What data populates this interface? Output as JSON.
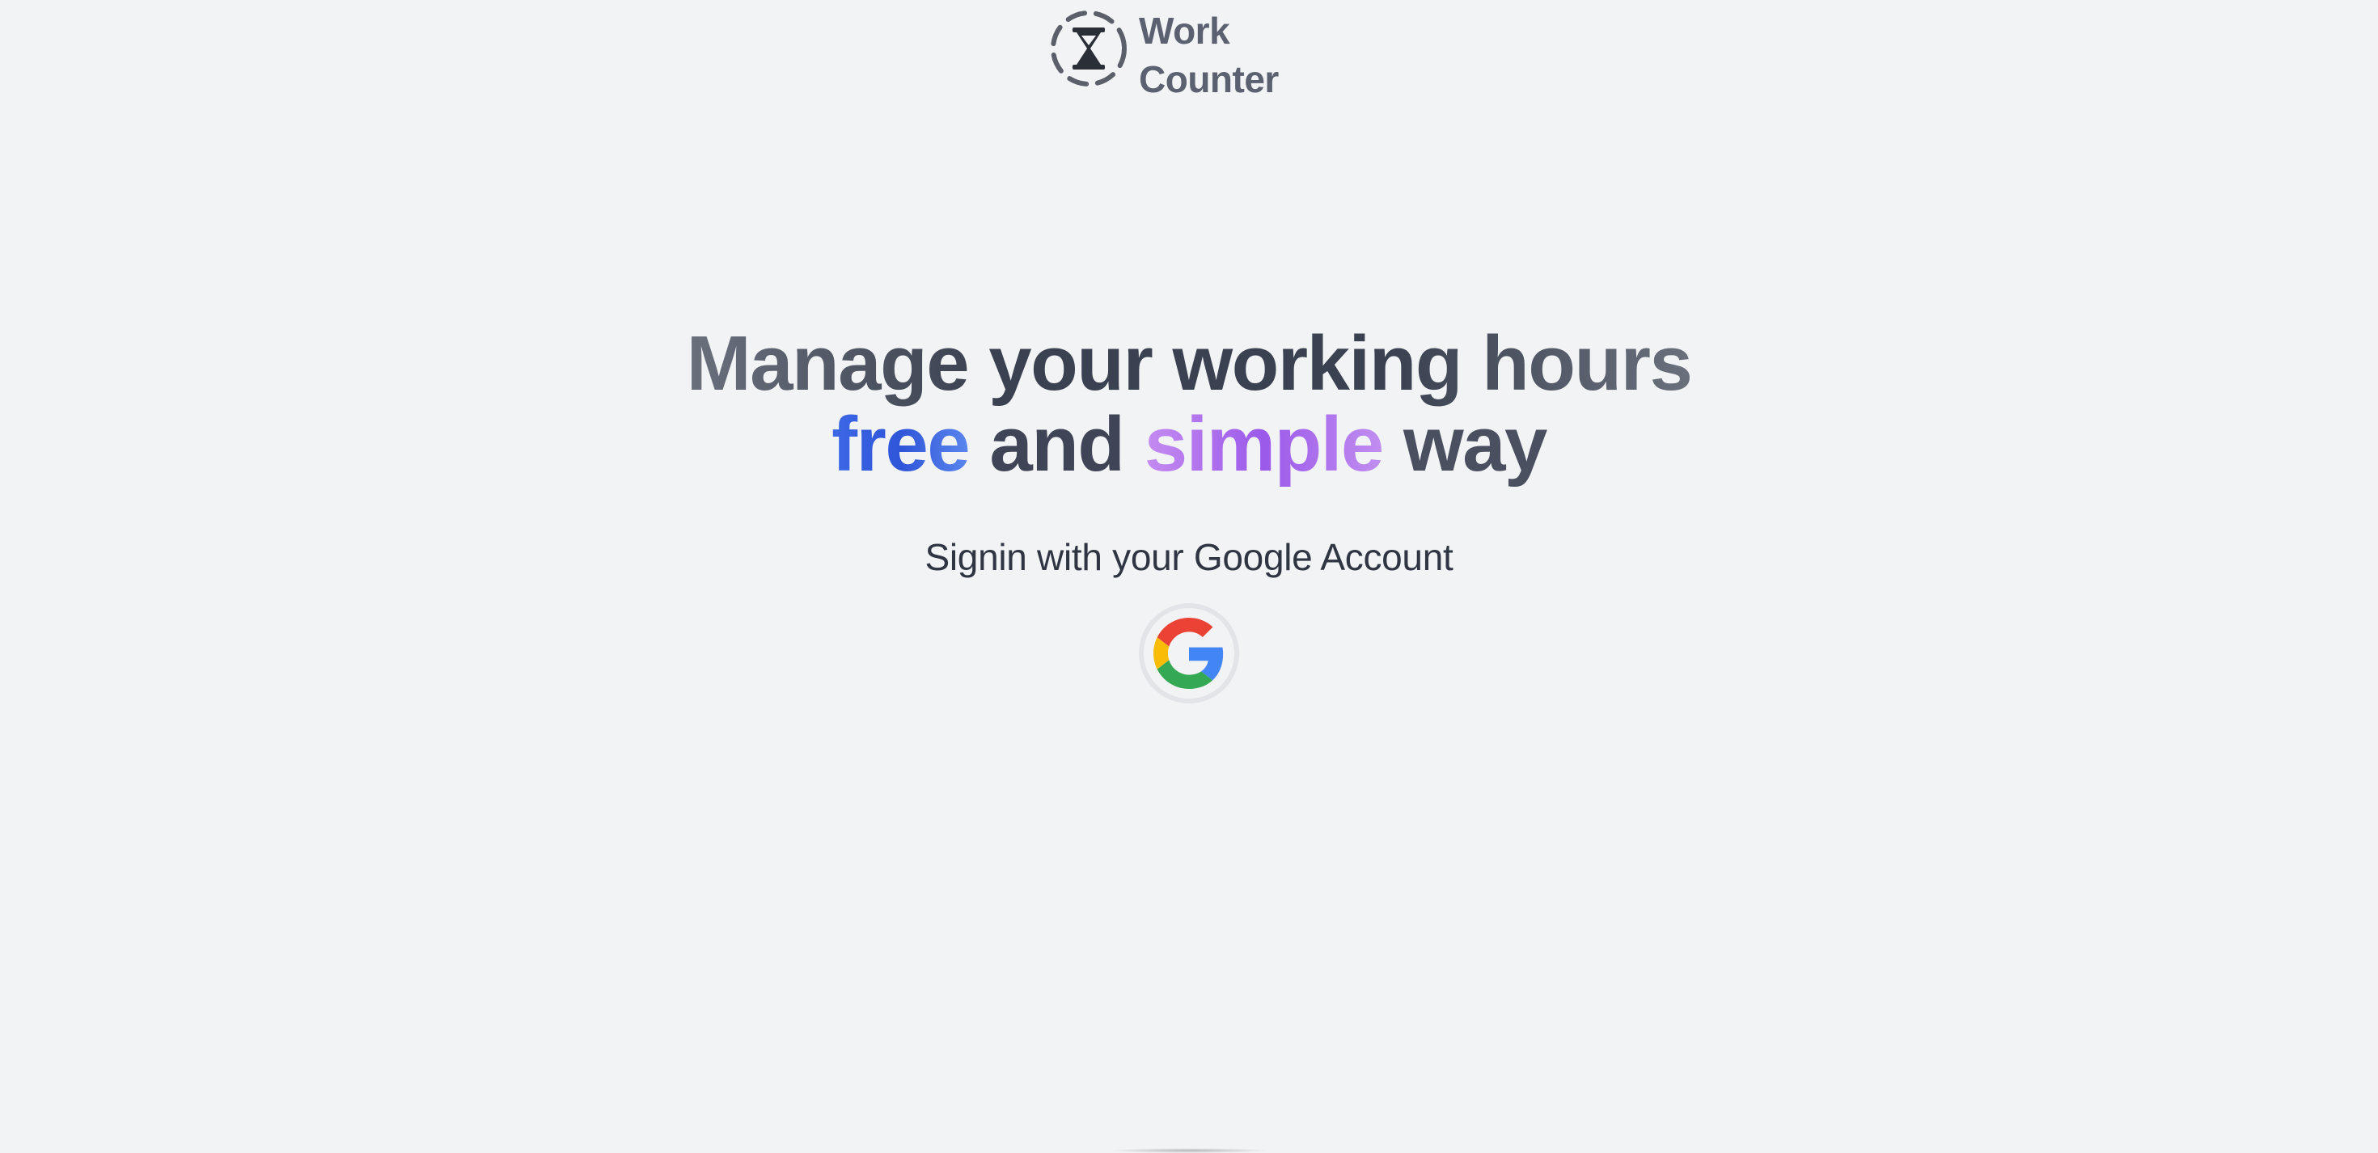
{
  "app": {
    "logo_line1": "Work",
    "logo_line2": "Counter",
    "logo_icon": "hourglass-icon"
  },
  "hero": {
    "headline_line1": "Manage your working hours",
    "word_free": "free",
    "word_and": "and",
    "word_simple": "simple",
    "word_way": "way",
    "subtitle": "Signin with your Google Account"
  },
  "signin": {
    "provider_icon": "google-icon"
  },
  "colors": {
    "background": "#f2f3f5",
    "free_gradient": [
      "#3c68e6",
      "#5b86ee"
    ],
    "simple_gradient": [
      "#c58cf0",
      "#9b59ea"
    ],
    "text_dark": "#3c4352"
  }
}
